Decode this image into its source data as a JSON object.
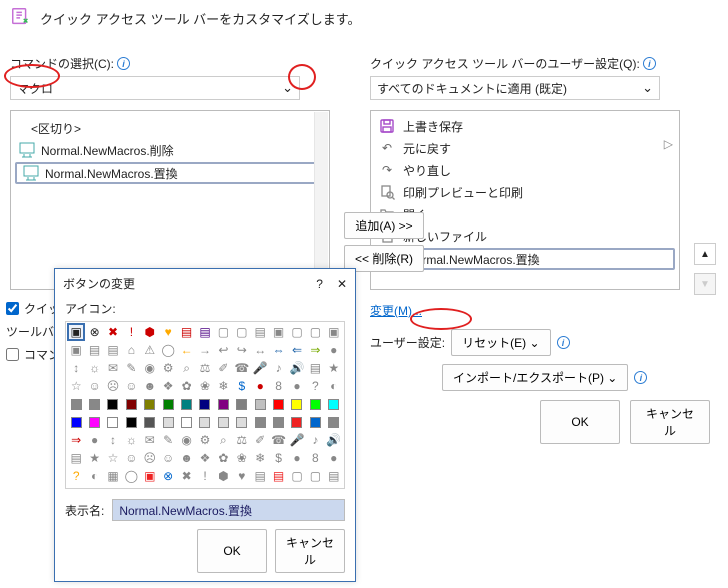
{
  "header": {
    "title": "クイック アクセス ツール バーをカスタマイズします。"
  },
  "left": {
    "label": "コマンドの選択(C):",
    "dropdown": "マクロ",
    "list": {
      "sep": "<区切り>",
      "items": [
        {
          "label": "Normal.NewMacros.削除"
        },
        {
          "label": "Normal.NewMacros.置換"
        }
      ]
    }
  },
  "right": {
    "label": "クイック アクセス ツール バーのユーザー設定(Q):",
    "dropdown": "すべてのドキュメントに適用 (既定)",
    "items": [
      {
        "label": "上書き保存"
      },
      {
        "label": "元に戻す"
      },
      {
        "label": "やり直し"
      },
      {
        "label": "印刷プレビューと印刷"
      },
      {
        "label": "開く"
      },
      {
        "label": "新しいファイル"
      },
      {
        "label": "Normal.NewMacros.置換"
      }
    ]
  },
  "middle": {
    "add": "追加(A) >>",
    "remove": "<< 削除(R)"
  },
  "under_left": {
    "chk_label": "クイック",
    "toolbar_label": "ツールバー",
    "chk2_label": "コマン"
  },
  "under_right": {
    "modify": "変更(M)...",
    "user_label": "ユーザー設定:",
    "reset": "リセット(E) ⌄",
    "importexport": "インポート/エクスポート(P) ⌄"
  },
  "footer": {
    "ok": "OK",
    "cancel": "キャンセル"
  },
  "dialog": {
    "title": "ボタンの変更",
    "help": "?",
    "close": "✕",
    "icons_label": "アイコン:",
    "name_label": "表示名:",
    "name_value": "Normal.NewMacros.置換",
    "ok": "OK",
    "cancel": "キャンセル"
  },
  "icon_grid_colors": [
    "#222",
    "#222",
    "#c00",
    "#c00",
    "#c00",
    "#fa0",
    "#c00",
    "#4b0082",
    "#888",
    "#888",
    "#888",
    "#888",
    "#888",
    "#888",
    "#888",
    "#888",
    "#888",
    "#888",
    "#888",
    "#888",
    "#888",
    "#fa0",
    "#888",
    "#888",
    "#888",
    "#888",
    "#26a",
    "#26a",
    "#7a0",
    "#888",
    "#888",
    "#888",
    "#888",
    "#888",
    "#888",
    "#888",
    "#888",
    "#888",
    "#888",
    "#888",
    "#26a",
    "#888",
    "#888",
    "#888",
    "#888",
    "#888",
    "#888",
    "#888",
    "#888",
    "#888",
    "#888",
    "#888",
    "#888",
    "#888",
    "#06c",
    "#c00",
    "#888",
    "#888",
    "#888",
    "#888",
    "#888",
    "#888",
    "#000",
    "#800000",
    "#808000",
    "#008000",
    "#008080",
    "#000080",
    "#800080",
    "#808080",
    "#c0c0c0",
    "#f00",
    "#ff0",
    "#0f0",
    "#0ff",
    "#00f",
    "#f0f",
    "#fff",
    "#000",
    "#555",
    "#ddd",
    "#fff",
    "#ddd",
    "#ddd",
    "#ddd",
    "#888",
    "#888",
    "#e22",
    "#06c",
    "#888",
    "#c00",
    "#888",
    "#888",
    "#888",
    "#888",
    "#888",
    "#888",
    "#888",
    "#888",
    "#888",
    "#888",
    "#888",
    "#888",
    "#888",
    "#888",
    "#888",
    "#888",
    "#888",
    "#888",
    "#888",
    "#888",
    "#888",
    "#888",
    "#888",
    "#888",
    "#888",
    "#888",
    "#888",
    "#888",
    "#888",
    "#fa0",
    "#888",
    "#888",
    "#888",
    "#e22",
    "#06c",
    "#888",
    "#888",
    "#888",
    "#888",
    "#888",
    "#e22",
    "#888",
    "#888",
    "#888",
    "#888",
    "#888",
    "#888",
    "#888",
    "#888",
    "#888",
    "#888",
    "#888",
    "#888",
    "#888",
    "#888",
    "#888",
    "#888",
    "#888",
    "#888",
    "#fa0",
    "#888",
    "#888",
    "#888",
    "#888",
    "#888",
    "#888",
    "#888",
    "#888",
    "#888",
    "#888",
    "#888",
    "#888",
    "#888",
    "#888"
  ],
  "chart_data": null
}
